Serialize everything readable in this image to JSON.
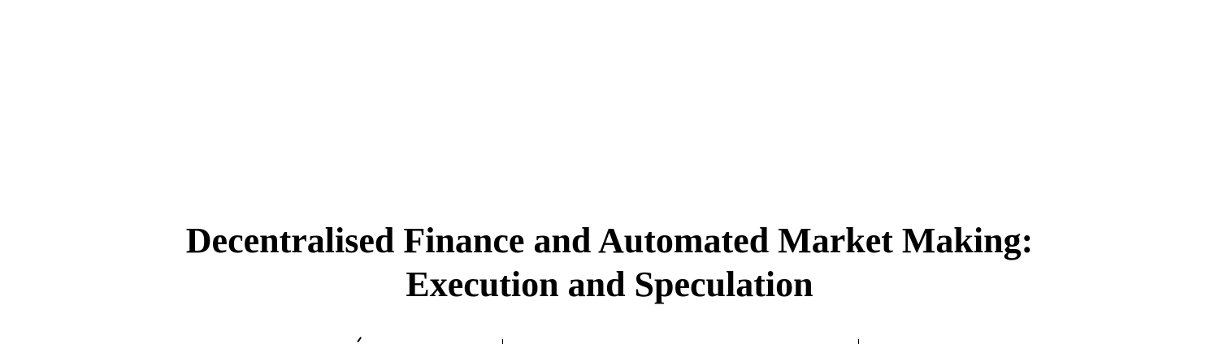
{
  "paper": {
    "title_lines": [
      "Decentralised Finance and Automated Market Making:",
      "Execution and Speculation"
    ]
  }
}
